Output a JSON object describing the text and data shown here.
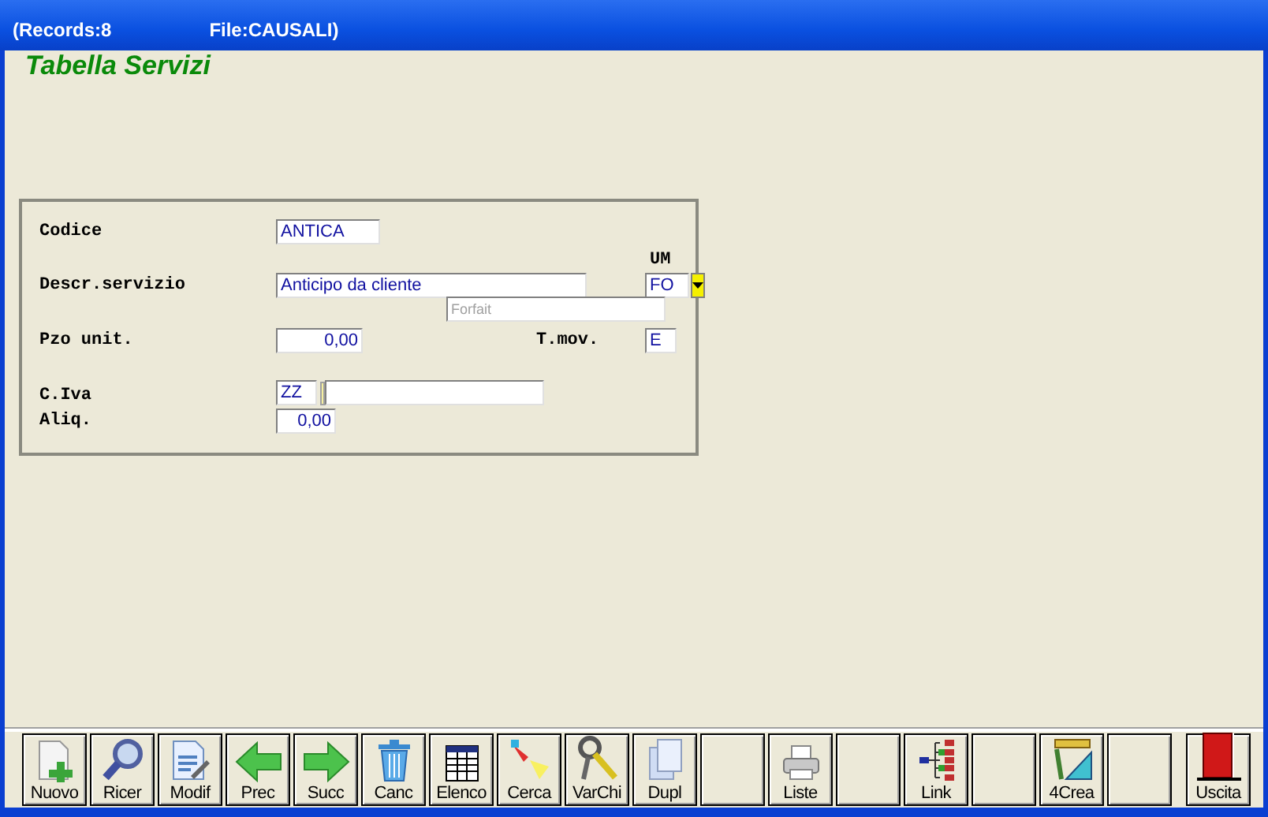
{
  "title_bar": {
    "records": "(Records:8",
    "file": "File:CAUSALI)"
  },
  "heading": "Tabella Servizi",
  "form": {
    "codice": {
      "label": "Codice",
      "value": "ANTICA"
    },
    "um_label": "UM",
    "descr": {
      "label": "Descr.servizio",
      "value": "Anticipo da cliente"
    },
    "um": {
      "value": "FO"
    },
    "um_desc": {
      "value": "Forfait",
      "disabled": true
    },
    "prezzo": {
      "label": "Pzo unit.",
      "value": "0,00"
    },
    "tmov": {
      "label": "T.mov.",
      "value": "E"
    },
    "iva": {
      "label": "C.Iva",
      "value": "ZZ"
    },
    "aliq": {
      "label": "Aliq.",
      "value": "0,00"
    }
  },
  "toolbar": [
    {
      "kind": "new",
      "label": "Nuovo"
    },
    {
      "kind": "search",
      "label": "Ricer"
    },
    {
      "kind": "edit",
      "label": "Modif"
    },
    {
      "kind": "prev",
      "label": "Prec"
    },
    {
      "kind": "next",
      "label": "Succ"
    },
    {
      "kind": "delete",
      "label": "Canc"
    },
    {
      "kind": "list",
      "label": "Elenco"
    },
    {
      "kind": "find",
      "label": "Cerca"
    },
    {
      "kind": "keys",
      "label": "VarChi"
    },
    {
      "kind": "copy",
      "label": "Dupl"
    },
    {
      "kind": "blank"
    },
    {
      "kind": "print",
      "label": "Liste"
    },
    {
      "kind": "blank"
    },
    {
      "kind": "link",
      "label": "Link"
    },
    {
      "kind": "blank"
    },
    {
      "kind": "create",
      "label": "4Crea"
    },
    {
      "kind": "blank"
    },
    {
      "kind": "exit",
      "label": "Uscita"
    }
  ]
}
